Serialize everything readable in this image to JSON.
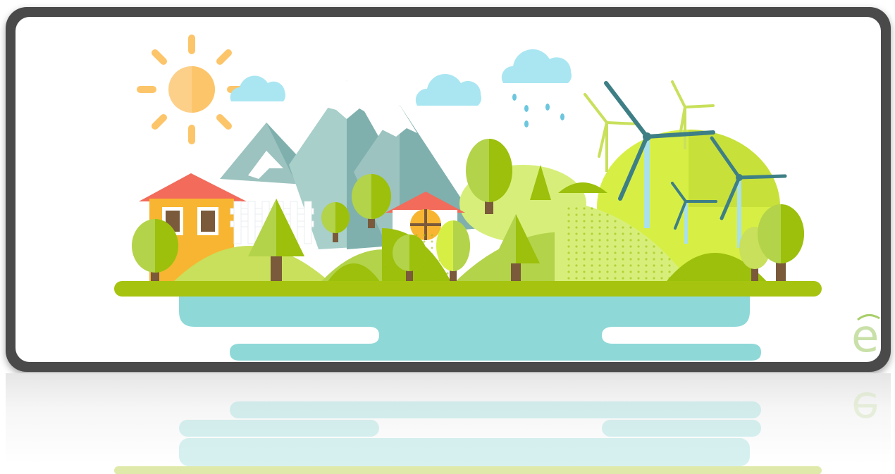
{
  "illustration": {
    "subject": "eco-friendly-village-landscape",
    "elements": [
      "sun",
      "clouds",
      "rain",
      "mountains",
      "houses",
      "trees",
      "hills",
      "wind-turbines",
      "lake"
    ],
    "logo_glyph": "e"
  },
  "colors": {
    "frame": "#4a4a4a",
    "sun": "#fdd08a",
    "sun_rays": "#fcc56a",
    "cloud": "#a9e6f2",
    "mountain_light": "#a8cfc9",
    "mountain_dark": "#7fb0ad",
    "snow": "#ffffff",
    "hill_dark": "#9cc00b",
    "hill_mid": "#b3d34a",
    "hill_light": "#d7ef7a",
    "tree_green": "#a6cc1e",
    "trunk": "#7a5a3a",
    "house_wall": "#f7b531",
    "roof": "#f26b5b",
    "window": "#7a5a3a",
    "turbine": "#3e7f86",
    "turbine_light": "#c8e05b",
    "water": "#8fd8d8",
    "ground": "#a6c40f",
    "logo": "#c9e0a8"
  }
}
